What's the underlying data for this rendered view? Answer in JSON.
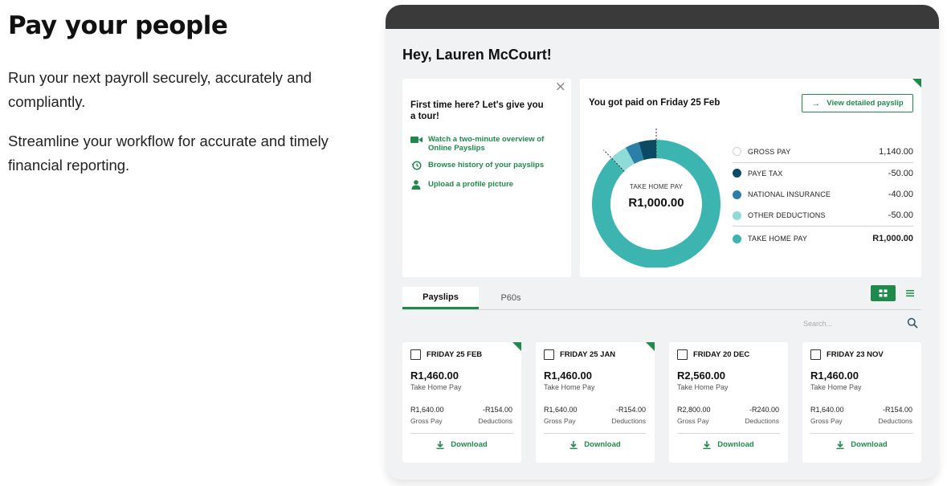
{
  "hero": {
    "title": "Pay your people",
    "p1": "Run your next payroll securely, accurately and compliantly.",
    "p2": "Streamline your workflow for accurate and timely financial reporting."
  },
  "app": {
    "greeting": "Hey, Lauren McCourt!",
    "tour": {
      "close": "×",
      "title": "First time here? Let's give you a tour!",
      "links": [
        {
          "label": "Watch a two-minute overview of Online Payslips",
          "icon": "video-icon"
        },
        {
          "label": "Browse history of your payslips",
          "icon": "history-icon"
        },
        {
          "label": "Upload a profile picture",
          "icon": "user-icon"
        }
      ]
    },
    "summary": {
      "title": "You got paid on Friday 25 Feb",
      "view_button": "View detailed payslip",
      "donut_label": "TAKE HOME PAY",
      "donut_value": "R1,000.00",
      "legend": [
        {
          "label": "GROSS PAY",
          "value": "1,140.00",
          "color": "#ffffff"
        },
        {
          "label": "PAYE TAX",
          "value": "-50.00",
          "color": "#0c4a63"
        },
        {
          "label": "NATIONAL INSURANCE",
          "value": "-40.00",
          "color": "#2b7fa8"
        },
        {
          "label": "OTHER DEDUCTIONS",
          "value": "-50.00",
          "color": "#8fdbd8"
        },
        {
          "label": "TAKE HOME PAY",
          "value": "R1,000.00",
          "color": "#3cb5b0"
        }
      ]
    },
    "chart_data": {
      "type": "pie",
      "categories": [
        "PAYE TAX",
        "NATIONAL INSURANCE",
        "OTHER DEDUCTIONS",
        "TAKE HOME PAY"
      ],
      "values": [
        50,
        40,
        50,
        1000
      ],
      "colors": [
        "#0c4a63",
        "#2b7fa8",
        "#8fdbd8",
        "#3cb5b0"
      ],
      "donut": true
    },
    "tabs": [
      {
        "label": "Payslips",
        "active": true
      },
      {
        "label": "P60s",
        "active": false
      }
    ],
    "search_placeholder": "Search...",
    "payslips": [
      {
        "date": "FRIDAY 25 FEB",
        "amount": "R1,460.00",
        "sub": "Take Home Pay",
        "gross": "R1,640.00",
        "gross_label": "Gross Pay",
        "deductions": "-R154.00",
        "deductions_label": "Deductions",
        "download": "Download",
        "new": true
      },
      {
        "date": "FRIDAY 25 JAN",
        "amount": "R1,460.00",
        "sub": "Take Home Pay",
        "gross": "R1,640.00",
        "gross_label": "Gross Pay",
        "deductions": "-R154.00",
        "deductions_label": "Deductions",
        "download": "Download",
        "new": true
      },
      {
        "date": "FRIDAY 20 DEC",
        "amount": "R2,560.00",
        "sub": "Take Home Pay",
        "gross": "R2,800.00",
        "gross_label": "Gross Pay",
        "deductions": "-R240.00",
        "deductions_label": "Deductions",
        "download": "Download",
        "new": false
      },
      {
        "date": "FRIDAY 23 NOV",
        "amount": "R1,460.00",
        "sub": "Take Home Pay",
        "gross": "R1,640.00",
        "gross_label": "Gross Pay",
        "deductions": "-R154.00",
        "deductions_label": "Deductions",
        "download": "Download",
        "new": false
      }
    ],
    "colors": {
      "accent": "#1f8a4c",
      "frame_bar": "#3a3a3a",
      "background": "#f0f2f3"
    }
  }
}
